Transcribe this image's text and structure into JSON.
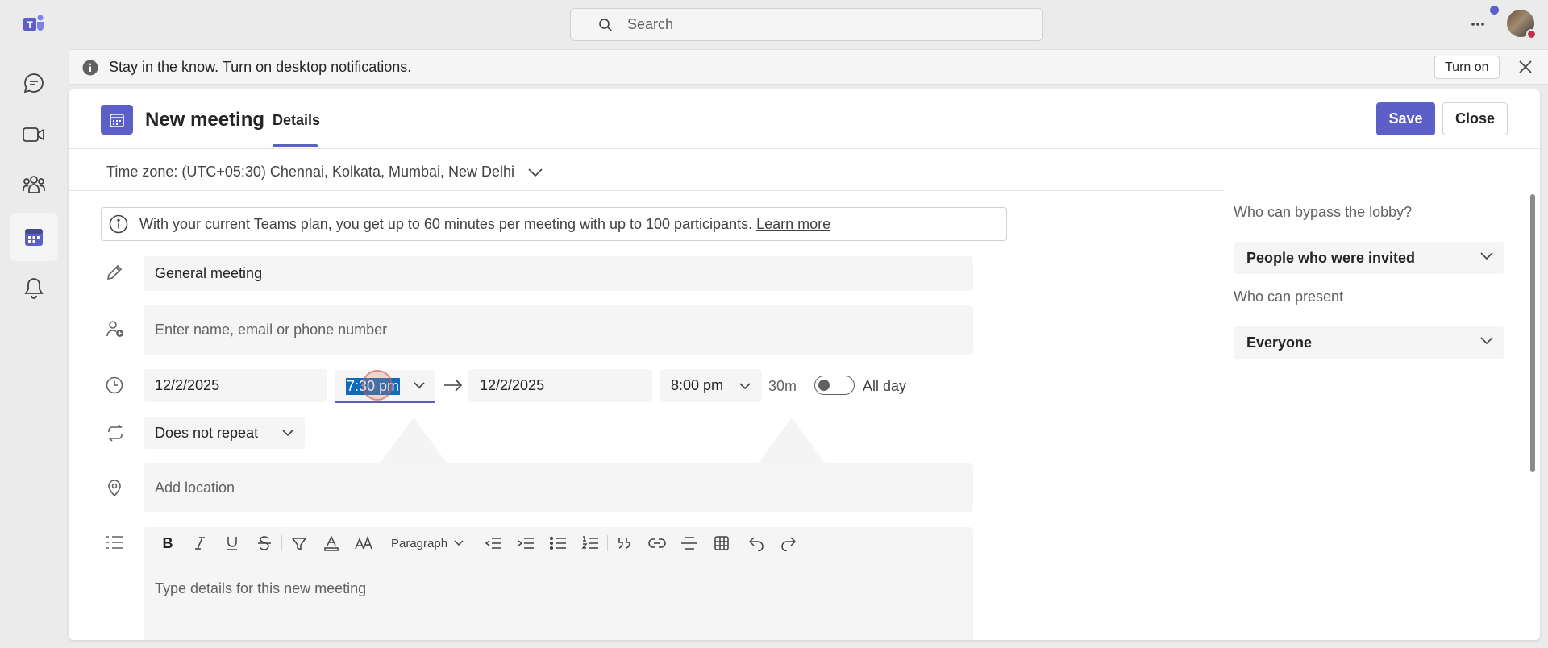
{
  "search": {
    "placeholder": "Search"
  },
  "banner": {
    "message": "Stay in the know. Turn on desktop notifications.",
    "turn_on_label": "Turn on"
  },
  "header": {
    "title": "New meeting",
    "tab": "Details",
    "save_label": "Save",
    "close_label": "Close"
  },
  "timezone": {
    "label": "Time zone: (UTC+05:30) Chennai, Kolkata, Mumbai, New Delhi"
  },
  "plan_note": {
    "text": "With your current Teams plan, you get up to 60 minutes per meeting with up to 100 participants.",
    "link": "Learn more"
  },
  "form": {
    "title_value": "General meeting",
    "attendees_placeholder": "Enter name, email or phone number",
    "start_date": "12/2/2025",
    "start_time": "7:30 pm",
    "end_date": "12/2/2025",
    "end_time": "8:00 pm",
    "duration": "30m",
    "all_day_label": "All day",
    "repeat": "Does not repeat",
    "location_placeholder": "Add location",
    "details_placeholder": "Type details for this new meeting",
    "paragraph_label": "Paragraph"
  },
  "sidebar": {
    "lobby_label": "Who can bypass the lobby?",
    "lobby_value": "People who were invited",
    "present_label": "Who can present",
    "present_value": "Everyone"
  },
  "colors": {
    "accent": "#5b5fc7",
    "selection": "#0f6cbd",
    "presence_busy": "#c4314b"
  },
  "icons": [
    "teams-logo-icon",
    "chat-icon",
    "video-icon",
    "people-icon",
    "calendar-icon",
    "bell-icon",
    "search-icon",
    "more-icon",
    "info-icon",
    "close-icon",
    "pencil-icon",
    "person-add-icon",
    "clock-icon",
    "repeat-icon",
    "location-icon",
    "list-icon"
  ]
}
